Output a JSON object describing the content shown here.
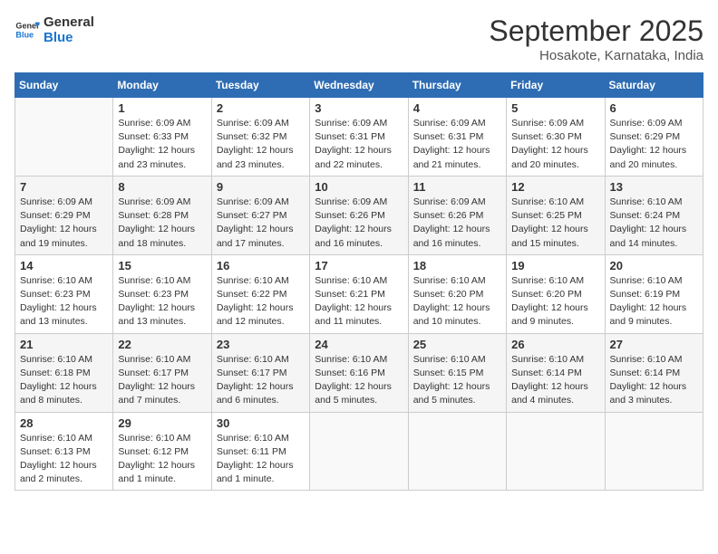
{
  "logo": {
    "line1": "General",
    "line2": "Blue"
  },
  "title": "September 2025",
  "subtitle": "Hosakote, Karnataka, India",
  "days_header": [
    "Sunday",
    "Monday",
    "Tuesday",
    "Wednesday",
    "Thursday",
    "Friday",
    "Saturday"
  ],
  "weeks": [
    [
      {
        "day": "",
        "info": ""
      },
      {
        "day": "1",
        "info": "Sunrise: 6:09 AM\nSunset: 6:33 PM\nDaylight: 12 hours\nand 23 minutes."
      },
      {
        "day": "2",
        "info": "Sunrise: 6:09 AM\nSunset: 6:32 PM\nDaylight: 12 hours\nand 23 minutes."
      },
      {
        "day": "3",
        "info": "Sunrise: 6:09 AM\nSunset: 6:31 PM\nDaylight: 12 hours\nand 22 minutes."
      },
      {
        "day": "4",
        "info": "Sunrise: 6:09 AM\nSunset: 6:31 PM\nDaylight: 12 hours\nand 21 minutes."
      },
      {
        "day": "5",
        "info": "Sunrise: 6:09 AM\nSunset: 6:30 PM\nDaylight: 12 hours\nand 20 minutes."
      },
      {
        "day": "6",
        "info": "Sunrise: 6:09 AM\nSunset: 6:29 PM\nDaylight: 12 hours\nand 20 minutes."
      }
    ],
    [
      {
        "day": "7",
        "info": "Sunrise: 6:09 AM\nSunset: 6:29 PM\nDaylight: 12 hours\nand 19 minutes."
      },
      {
        "day": "8",
        "info": "Sunrise: 6:09 AM\nSunset: 6:28 PM\nDaylight: 12 hours\nand 18 minutes."
      },
      {
        "day": "9",
        "info": "Sunrise: 6:09 AM\nSunset: 6:27 PM\nDaylight: 12 hours\nand 17 minutes."
      },
      {
        "day": "10",
        "info": "Sunrise: 6:09 AM\nSunset: 6:26 PM\nDaylight: 12 hours\nand 16 minutes."
      },
      {
        "day": "11",
        "info": "Sunrise: 6:09 AM\nSunset: 6:26 PM\nDaylight: 12 hours\nand 16 minutes."
      },
      {
        "day": "12",
        "info": "Sunrise: 6:10 AM\nSunset: 6:25 PM\nDaylight: 12 hours\nand 15 minutes."
      },
      {
        "day": "13",
        "info": "Sunrise: 6:10 AM\nSunset: 6:24 PM\nDaylight: 12 hours\nand 14 minutes."
      }
    ],
    [
      {
        "day": "14",
        "info": "Sunrise: 6:10 AM\nSunset: 6:23 PM\nDaylight: 12 hours\nand 13 minutes."
      },
      {
        "day": "15",
        "info": "Sunrise: 6:10 AM\nSunset: 6:23 PM\nDaylight: 12 hours\nand 13 minutes."
      },
      {
        "day": "16",
        "info": "Sunrise: 6:10 AM\nSunset: 6:22 PM\nDaylight: 12 hours\nand 12 minutes."
      },
      {
        "day": "17",
        "info": "Sunrise: 6:10 AM\nSunset: 6:21 PM\nDaylight: 12 hours\nand 11 minutes."
      },
      {
        "day": "18",
        "info": "Sunrise: 6:10 AM\nSunset: 6:20 PM\nDaylight: 12 hours\nand 10 minutes."
      },
      {
        "day": "19",
        "info": "Sunrise: 6:10 AM\nSunset: 6:20 PM\nDaylight: 12 hours\nand 9 minutes."
      },
      {
        "day": "20",
        "info": "Sunrise: 6:10 AM\nSunset: 6:19 PM\nDaylight: 12 hours\nand 9 minutes."
      }
    ],
    [
      {
        "day": "21",
        "info": "Sunrise: 6:10 AM\nSunset: 6:18 PM\nDaylight: 12 hours\nand 8 minutes."
      },
      {
        "day": "22",
        "info": "Sunrise: 6:10 AM\nSunset: 6:17 PM\nDaylight: 12 hours\nand 7 minutes."
      },
      {
        "day": "23",
        "info": "Sunrise: 6:10 AM\nSunset: 6:17 PM\nDaylight: 12 hours\nand 6 minutes."
      },
      {
        "day": "24",
        "info": "Sunrise: 6:10 AM\nSunset: 6:16 PM\nDaylight: 12 hours\nand 5 minutes."
      },
      {
        "day": "25",
        "info": "Sunrise: 6:10 AM\nSunset: 6:15 PM\nDaylight: 12 hours\nand 5 minutes."
      },
      {
        "day": "26",
        "info": "Sunrise: 6:10 AM\nSunset: 6:14 PM\nDaylight: 12 hours\nand 4 minutes."
      },
      {
        "day": "27",
        "info": "Sunrise: 6:10 AM\nSunset: 6:14 PM\nDaylight: 12 hours\nand 3 minutes."
      }
    ],
    [
      {
        "day": "28",
        "info": "Sunrise: 6:10 AM\nSunset: 6:13 PM\nDaylight: 12 hours\nand 2 minutes."
      },
      {
        "day": "29",
        "info": "Sunrise: 6:10 AM\nSunset: 6:12 PM\nDaylight: 12 hours\nand 1 minute."
      },
      {
        "day": "30",
        "info": "Sunrise: 6:10 AM\nSunset: 6:11 PM\nDaylight: 12 hours\nand 1 minute."
      },
      {
        "day": "",
        "info": ""
      },
      {
        "day": "",
        "info": ""
      },
      {
        "day": "",
        "info": ""
      },
      {
        "day": "",
        "info": ""
      }
    ]
  ]
}
